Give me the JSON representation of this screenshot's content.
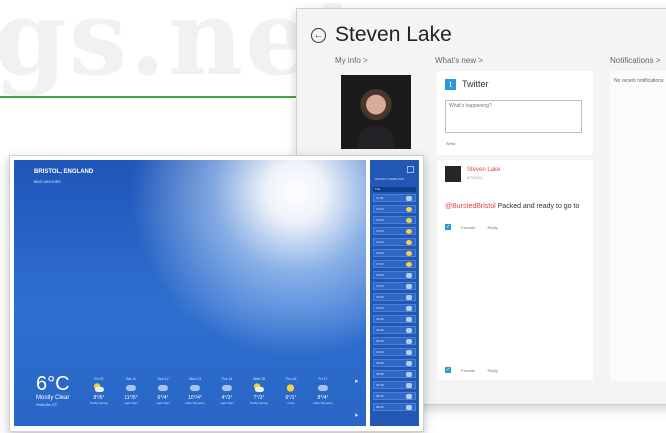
{
  "watermark": "gs.net",
  "people_app": {
    "name": "Steven Lake",
    "sections": {
      "my_info": "My info >",
      "whats_new": "What's new >",
      "notifications": "Notifications >"
    },
    "twitter": {
      "title": "Twitter",
      "placeholder": "What's happening?",
      "send_label": "Send"
    },
    "post": {
      "author": "Steven Lake",
      "date": "6/3/2012",
      "mention": "@BurstedBristol",
      "text": " Packed and ready to go to",
      "actions": [
        "Favorite",
        "Reply"
      ]
    },
    "notifications_text": "No recent notifications"
  },
  "weather_app": {
    "location": "BRISTOL, ENGLAND",
    "brand": "BING WEATHER",
    "current": {
      "temp": "6°C",
      "condition": "Mostly Clear",
      "details": "Feels like 4°C"
    },
    "forecast": [
      {
        "day": "Fri 10",
        "hilo": "8°/6°",
        "cond": "Partly Cloudy",
        "icon": "partly-cloudy-icon"
      },
      {
        "day": "Sat 11",
        "hilo": "11°/5°",
        "cond": "Light Rain",
        "icon": "cloud-icon"
      },
      {
        "day": "Sun 12",
        "hilo": "6°/4°",
        "cond": "Light Rain",
        "icon": "cloud-icon"
      },
      {
        "day": "Mon 13",
        "hilo": "10°/4°",
        "cond": "Rain Showers",
        "icon": "cloud-icon"
      },
      {
        "day": "Tue 14",
        "hilo": "4°/3°",
        "cond": "Light Rain",
        "icon": "cloud-icon"
      },
      {
        "day": "Wed 15",
        "hilo": "7°/3°",
        "cond": "Partly Cloudy",
        "icon": "partly-cloudy-icon"
      },
      {
        "day": "Thu 16",
        "hilo": "6°/1°",
        "cond": "Clear",
        "icon": "sun-icon"
      },
      {
        "day": "Fri 17",
        "hilo": "8°/4°",
        "cond": "Rain Showers",
        "icon": "cloud-icon"
      }
    ],
    "hourly": {
      "header": "HOURLY FORECAST",
      "day_label": "Tue",
      "times": [
        "11:00",
        "12:00",
        "13:00",
        "14:00",
        "15:00",
        "16:00",
        "17:00",
        "18:00",
        "19:00",
        "20:00",
        "21:00",
        "22:00",
        "23:00",
        "00:00",
        "01:00",
        "02:00",
        "03:00",
        "04:00",
        "05:00",
        "06:00"
      ],
      "icons": [
        "cloud",
        "sun",
        "sun",
        "sun",
        "sun",
        "sun",
        "sun",
        "cloud",
        "cloud",
        "cloud",
        "cloud",
        "cloud",
        "cloud",
        "cloud",
        "cloud",
        "cloud",
        "cloud",
        "cloud",
        "cloud",
        "cloud"
      ]
    },
    "colors": {
      "sky": "#2f6fd0",
      "panel": "#2257b5",
      "accent": "#f7d33a"
    }
  }
}
